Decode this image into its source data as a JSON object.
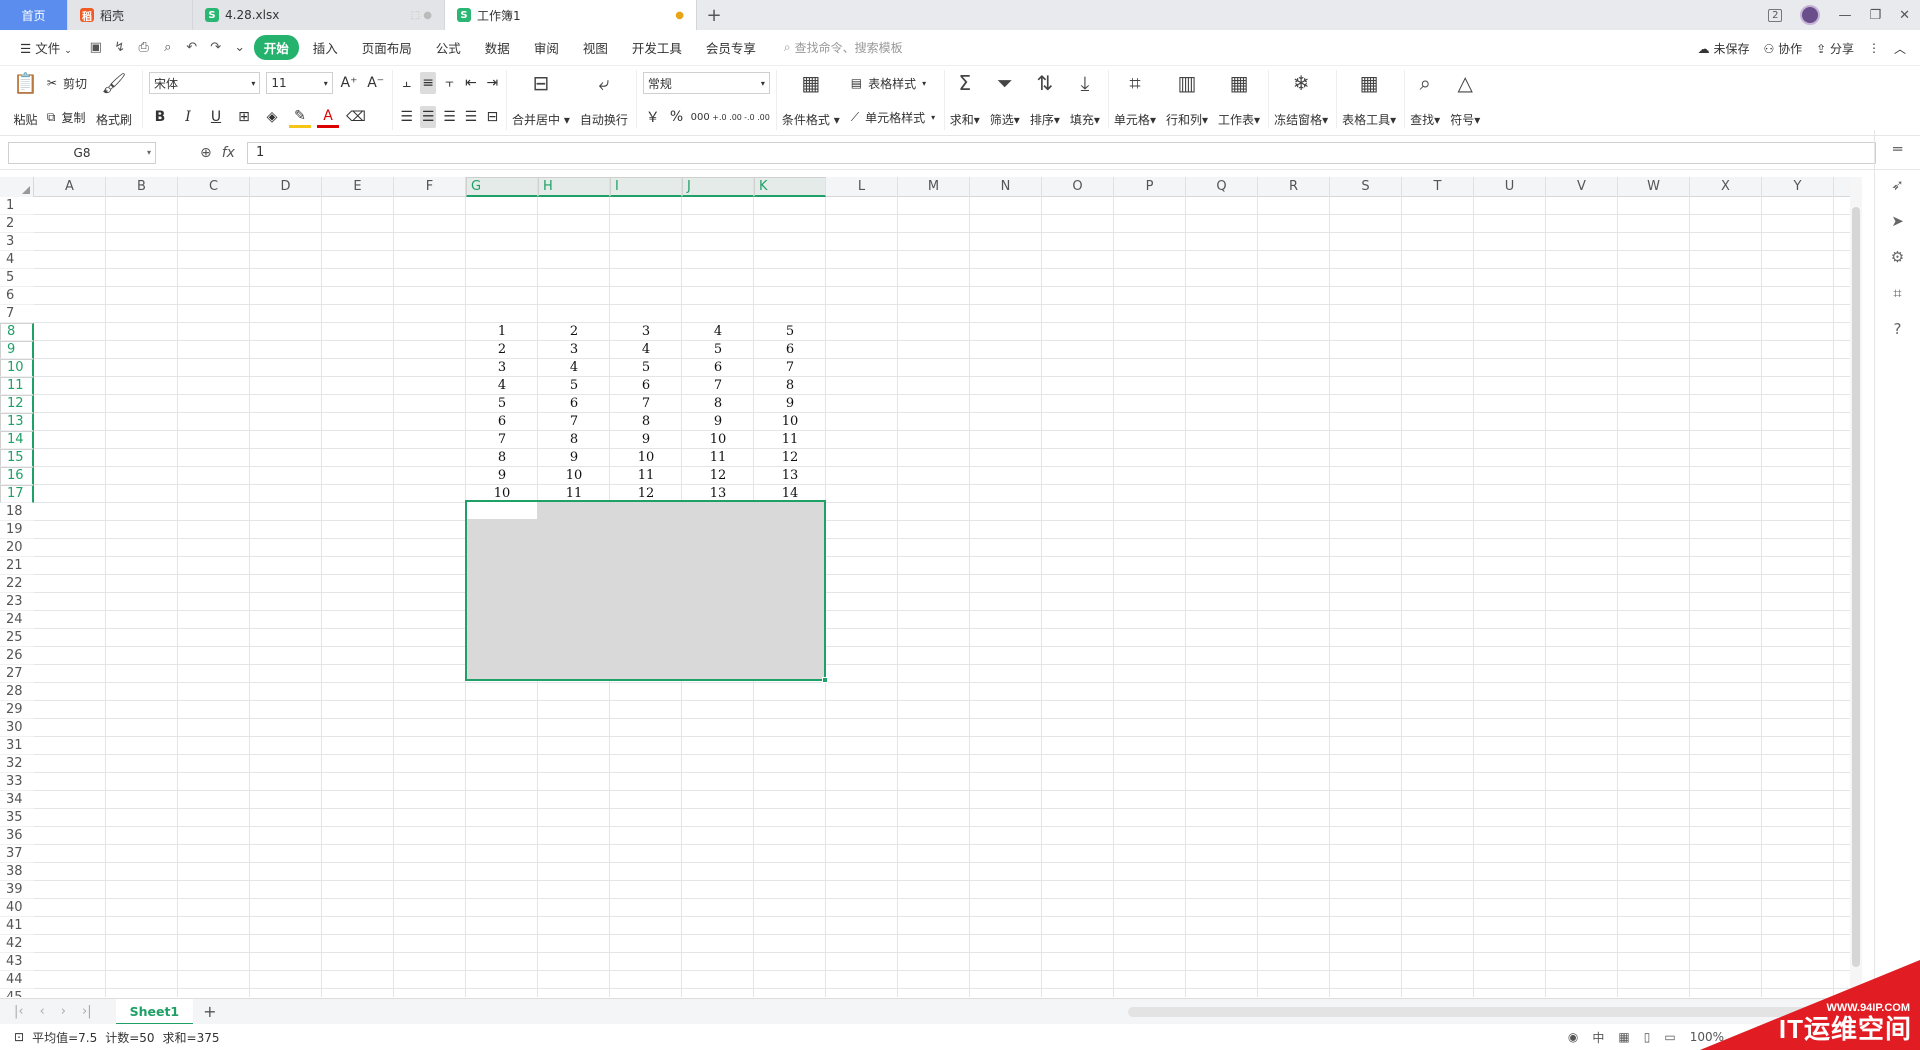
{
  "tabs": {
    "home": "首页",
    "docer": "稻壳",
    "file1": "4.28.xlsx",
    "file2": "工作簿1",
    "badge": "2"
  },
  "menu": {
    "file": "文件",
    "items": [
      "开始",
      "插入",
      "页面布局",
      "公式",
      "数据",
      "审阅",
      "视图",
      "开发工具",
      "会员专享"
    ],
    "search_placeholder": "查找命令、搜索模板",
    "unsaved": "未保存",
    "collab": "协作",
    "share": "分享"
  },
  "ribbon": {
    "paste": "粘贴",
    "cut": "剪切",
    "copy": "复制",
    "format_painter": "格式刷",
    "font_name": "宋体",
    "font_size": "11",
    "merge_center": "合并居中",
    "wrap_text": "自动换行",
    "number_format": "常规",
    "conditional_format": "条件格式",
    "table_style": "表格样式",
    "cell_style": "单元格样式",
    "sum": "求和",
    "filter": "筛选",
    "sort": "排序",
    "fill": "填充",
    "cell": "单元格",
    "row_col": "行和列",
    "worksheet": "工作表",
    "freeze": "冻结窗格",
    "table_tools": "表格工具",
    "find": "查找",
    "symbol": "符号",
    "currency": "￥",
    "percent": "%",
    "thousands": "000",
    "inc_decimal": "+.0 .00",
    "dec_decimal": "-.0 .00"
  },
  "formula_bar": {
    "name_box": "G8",
    "fx": "fx",
    "content": "1"
  },
  "columns": [
    "A",
    "B",
    "C",
    "D",
    "E",
    "F",
    "G",
    "H",
    "I",
    "J",
    "K",
    "L",
    "M",
    "N",
    "O",
    "P",
    "Q",
    "R",
    "S",
    "T",
    "U",
    "V",
    "W",
    "X",
    "Y"
  ],
  "selected_columns": [
    "G",
    "H",
    "I",
    "J",
    "K"
  ],
  "rows": [
    "1",
    "2",
    "3",
    "4",
    "5",
    "6",
    "7",
    "8",
    "9",
    "10",
    "11",
    "12",
    "13",
    "14",
    "15",
    "16",
    "17",
    "18",
    "19",
    "20",
    "21",
    "22",
    "23",
    "24",
    "25",
    "26",
    "27",
    "28",
    "29",
    "30",
    "31",
    "32",
    "33",
    "34",
    "35",
    "36",
    "37",
    "38",
    "39",
    "40",
    "41",
    "42",
    "43",
    "44",
    "45"
  ],
  "selected_rows": [
    "8",
    "9",
    "10",
    "11",
    "12",
    "13",
    "14",
    "15",
    "16",
    "17"
  ],
  "table": [
    [
      "1",
      "2",
      "3",
      "4",
      "5"
    ],
    [
      "2",
      "3",
      "4",
      "5",
      "6"
    ],
    [
      "3",
      "4",
      "5",
      "6",
      "7"
    ],
    [
      "4",
      "5",
      "6",
      "7",
      "8"
    ],
    [
      "5",
      "6",
      "7",
      "8",
      "9"
    ],
    [
      "6",
      "7",
      "8",
      "9",
      "10"
    ],
    [
      "7",
      "8",
      "9",
      "10",
      "11"
    ],
    [
      "8",
      "9",
      "10",
      "11",
      "12"
    ],
    [
      "9",
      "10",
      "11",
      "12",
      "13"
    ],
    [
      "10",
      "11",
      "12",
      "13",
      "14"
    ]
  ],
  "sheet_tab": "Sheet1",
  "status": {
    "average": "平均值=7.5",
    "count": "计数=50",
    "sum": "求和=375",
    "zoom": "100%",
    "lang": "中"
  },
  "watermark": {
    "url": "WWW.94IP.COM",
    "name": "IT运维空间"
  },
  "colors": {
    "accent": "#1fa066",
    "home_tab": "#5b8def",
    "selection_fill": "#d9d9d9"
  }
}
